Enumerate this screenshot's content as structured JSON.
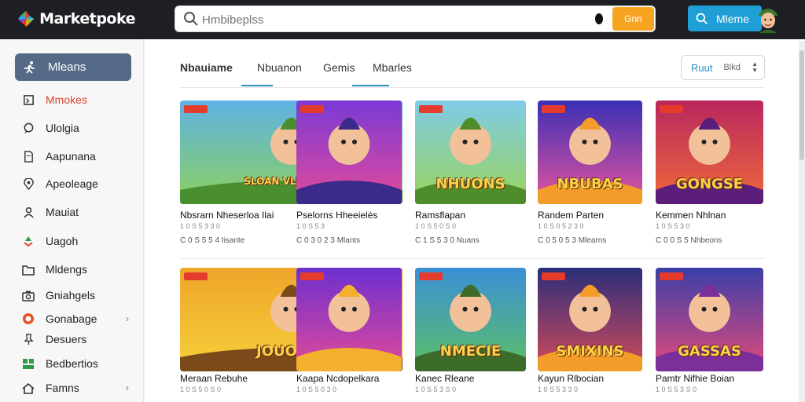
{
  "app": {
    "logo_text": "Marketpoke",
    "search_placeholder": "Hmbibeplss",
    "search_button": "Gnn",
    "menu_button": "Mleme"
  },
  "sidebar": {
    "active": {
      "label": "Mleans",
      "icon": "running-figure-icon"
    },
    "items": [
      {
        "label": "Mmokes",
        "icon": "square-icon",
        "accent": true
      },
      {
        "label": "Ulolgia",
        "icon": "chat-icon"
      },
      {
        "label": "Aapunana",
        "icon": "document-icon"
      },
      {
        "label": "Apeoleage",
        "icon": "location-pin-icon"
      },
      {
        "label": "Mauiat",
        "icon": "person-icon"
      },
      {
        "label": "Uagoh",
        "icon": "recycle-icon"
      },
      {
        "label": "Mldengs",
        "icon": "folder-icon"
      },
      {
        "label": "Gniahgels",
        "icon": "camera-icon"
      },
      {
        "label": "Gonabage",
        "icon": "orange-circle-icon",
        "chevron": true
      },
      {
        "label": "Desuers",
        "icon": "pin-icon"
      },
      {
        "label": "Bedbertios",
        "icon": "people-icon"
      },
      {
        "label": "Famns",
        "icon": "home-icon",
        "chevron": true
      }
    ]
  },
  "tabs": [
    {
      "label": "Nbauiame",
      "active": true
    },
    {
      "label": "Nbuanon"
    },
    {
      "label": "Gemis"
    },
    {
      "label": "Mbarles"
    }
  ],
  "sort": {
    "primary": "Ruut",
    "secondary": "Blkd"
  },
  "cards": [
    {
      "title": "Nbsrarn Nheserloa Ilai",
      "meta1": "1 0 S 5 3 3 0",
      "meta2": "C 0 S 5 5 4 Iisante",
      "art": "SLOAN VLUNEUSS"
    },
    {
      "title": "Pselorns Hheeielès",
      "meta1": "1 0 S 5 3",
      "meta2": "C 0 3 0 2 3 Mlants",
      "art": ""
    },
    {
      "title": "Ramsflapan",
      "meta1": "1 0 S 5 0 S 0",
      "meta2": "C 1 S 5 3 0 Nuans",
      "art": "NHUONS"
    },
    {
      "title": "Randem Parten",
      "meta1": "1 0 S 0 5 2 3 0",
      "meta2": "C 0 5 0 5 3 Mlearns",
      "art": "NBUBAS"
    },
    {
      "title": "Kemmen Nhlnan",
      "meta1": "1 0 S 5 3 0",
      "meta2": "C 0 0 S 5 Nhbeons",
      "art": "GONGSE"
    },
    {
      "title": "Meraan Rebuhe",
      "meta1": "1 0 S 5 0 S 0",
      "meta2": "C 0 S 5 3 0",
      "art": "JOUORD!"
    },
    {
      "title": "Kaapa Ncdopelkara",
      "meta1": "1 0 S 5 0 3 0",
      "meta2": "C 0 S 5 3 0",
      "art": ""
    },
    {
      "title": "Kanec Rleane",
      "meta1": "1 0 S 5 3 S 0",
      "meta2": "C 0 0 3 0",
      "art": "NMECIE"
    },
    {
      "title": "Kayun Rlbocian",
      "meta1": "1 0 S 5 3 3 0",
      "meta2": "C 0 S 5 5",
      "art": "SMIXINS"
    },
    {
      "title": "Pamtr Nifhie Boian",
      "meta1": "1 0 S 5 3 S 0",
      "meta2": "C 0 S 5 0",
      "art": "GASSAS"
    }
  ],
  "colors": {
    "accent": "#2e8fc3",
    "orange": "#f7a521",
    "topbar": "#1d1f24",
    "sidebar_active": "#546a86"
  }
}
